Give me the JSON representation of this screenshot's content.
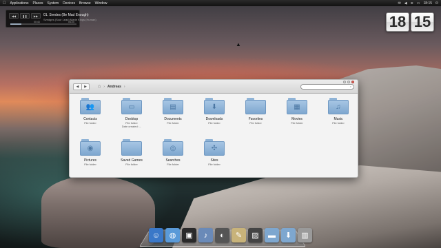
{
  "top_panel": {
    "menu": [
      "Applications",
      "Places",
      "System",
      "Devices",
      "Browse",
      "Window"
    ],
    "clock": "18:15"
  },
  "music_widget": {
    "track": "01. Svedes (Be Mad Enough)",
    "artist": "Svedges (Sour Lead) Marie Kings (Human)",
    "elapsed": "00:43",
    "total": "04:24",
    "progress": 0.17
  },
  "flip_clock": {
    "hours": "18",
    "minutes": "15"
  },
  "file_window": {
    "breadcrumb": "Andreas",
    "items": [
      {
        "name": "Contacts",
        "kind": "File folder",
        "extra": "",
        "icon": "people-icon"
      },
      {
        "name": "Desktop",
        "kind": "File folder",
        "extra": "Date created: ...",
        "icon": "monitor-icon"
      },
      {
        "name": "Documents",
        "kind": "File folder",
        "extra": "",
        "icon": "document-icon"
      },
      {
        "name": "Downloads",
        "kind": "File folder",
        "extra": "",
        "icon": "download-icon"
      },
      {
        "name": "Favorites",
        "kind": "File folder",
        "extra": "",
        "icon": "star-icon"
      },
      {
        "name": "Movies",
        "kind": "File folder",
        "extra": "",
        "icon": "film-icon"
      },
      {
        "name": "Music",
        "kind": "File folder",
        "extra": "",
        "icon": "music-note-icon"
      },
      {
        "name": "Pictures",
        "kind": "File folder",
        "extra": "",
        "icon": "camera-icon"
      },
      {
        "name": "Saved Games",
        "kind": "File folder",
        "extra": "",
        "icon": "gamepad-icon"
      },
      {
        "name": "Searches",
        "kind": "File folder",
        "extra": "",
        "icon": "magnifier-icon"
      },
      {
        "name": "Sites",
        "kind": "File folder",
        "extra": "",
        "icon": "compass-icon"
      }
    ]
  },
  "dock": {
    "items": [
      {
        "name": "finder",
        "icon": "finder-icon",
        "color": "#3a78c8"
      },
      {
        "name": "safari",
        "icon": "globe-icon",
        "color": "#5a9ad8"
      },
      {
        "name": "terminal",
        "icon": "terminal-icon",
        "color": "#2a2a2a"
      },
      {
        "name": "itunes",
        "icon": "music-icon",
        "color": "#6a8ab8"
      },
      {
        "name": "dashboard",
        "icon": "gauge-icon",
        "color": "#555555"
      },
      {
        "name": "notes",
        "icon": "notes-icon",
        "color": "#c8b37a"
      },
      {
        "name": "photos",
        "icon": "photo-icon",
        "color": "#444444"
      },
      {
        "name": "home-folder",
        "icon": "folder-icon",
        "color": "#7ea7cf"
      },
      {
        "name": "downloads-stack",
        "icon": "download-icon",
        "color": "#7ea7cf"
      },
      {
        "name": "trash",
        "icon": "trash-icon",
        "color": "#9a9a9a"
      }
    ]
  }
}
